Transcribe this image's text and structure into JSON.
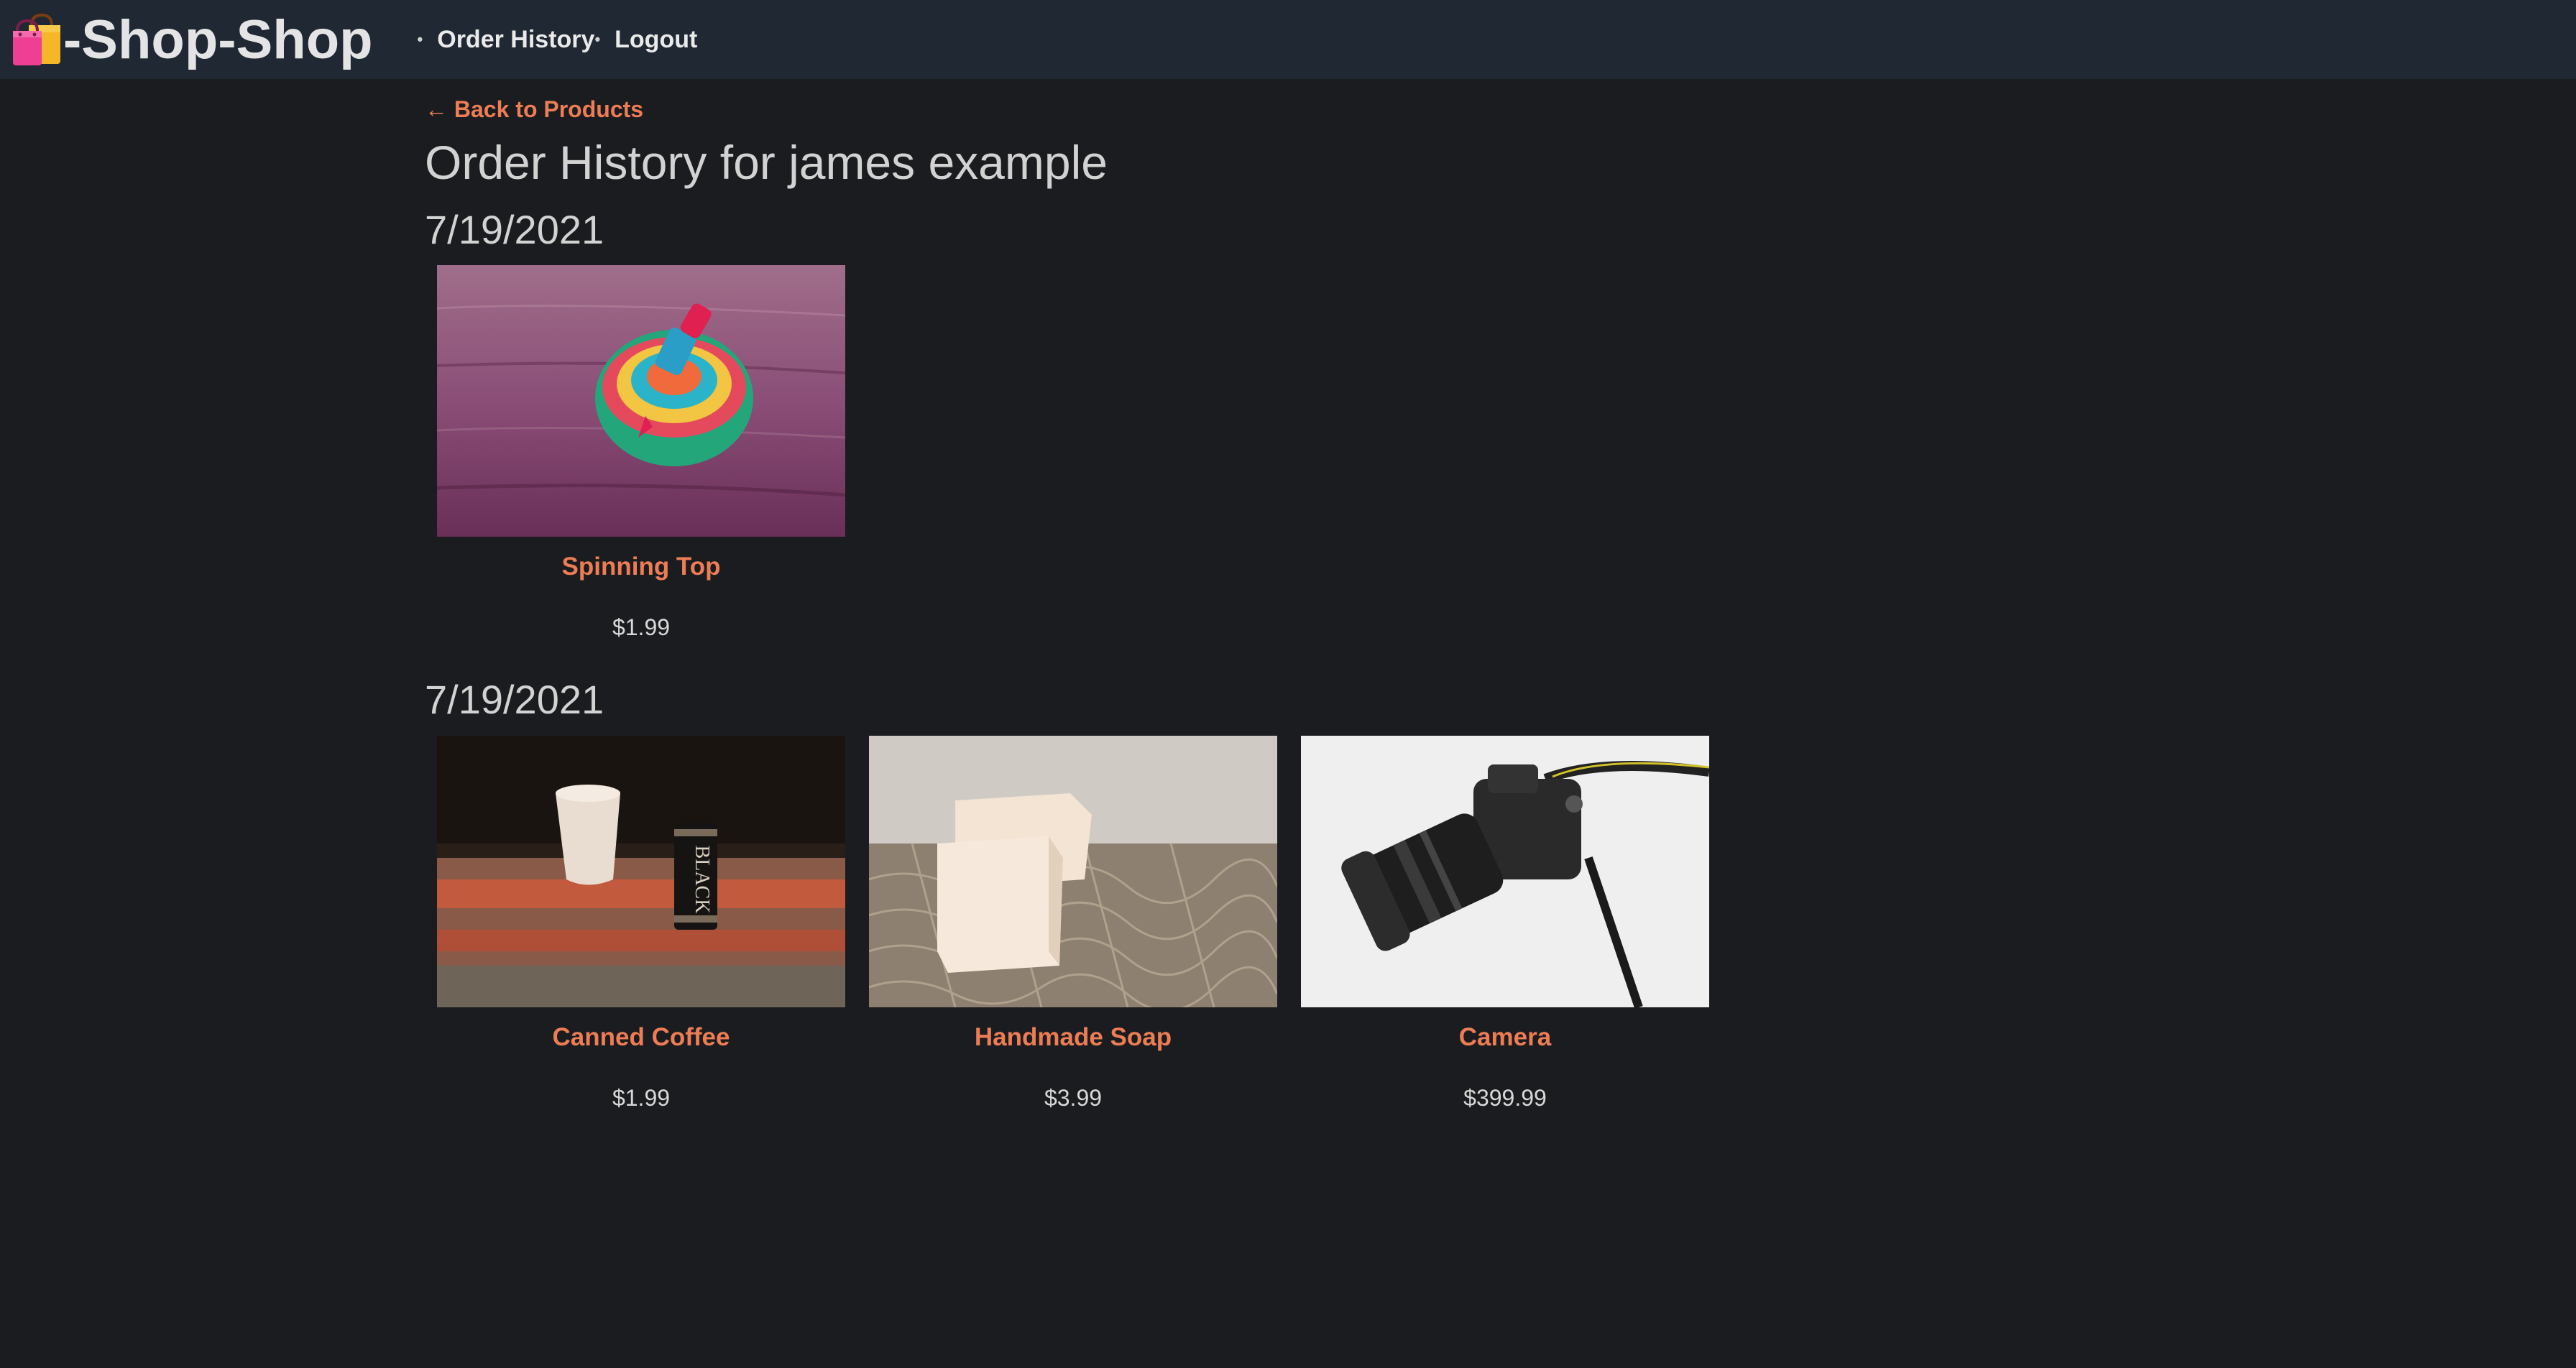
{
  "brand": {
    "icon": "shopping-bags-icon",
    "name": "-Shop-Shop"
  },
  "nav": {
    "items": [
      {
        "label": "Order History"
      },
      {
        "label": "Logout"
      }
    ],
    "bullet": "•"
  },
  "back_link": {
    "label": "← Back to Products"
  },
  "page_title": "Order History for james example",
  "orders": [
    {
      "date": "7/19/2021",
      "items": [
        {
          "name": "Spinning Top",
          "price": "$1.99",
          "image": "spinning-top-image"
        }
      ]
    },
    {
      "date": "7/19/2021",
      "items": [
        {
          "name": "Canned Coffee",
          "price": "$1.99",
          "image": "canned-coffee-image"
        },
        {
          "name": "Handmade Soap",
          "price": "$3.99",
          "image": "handmade-soap-image"
        },
        {
          "name": "Camera",
          "price": "$399.99",
          "image": "camera-image"
        }
      ]
    }
  ],
  "colors": {
    "background": "#1b1c1f",
    "navbar": "#1f2833",
    "accent": "#ec7d55",
    "text": "#d2d2d2"
  }
}
